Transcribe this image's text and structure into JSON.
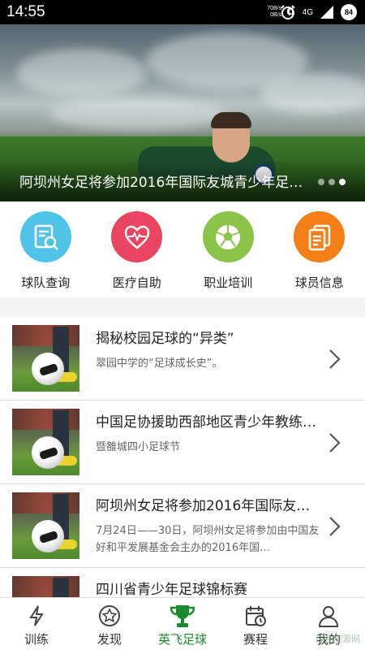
{
  "status_bar": {
    "time": "14:55",
    "net_up": "70B/s",
    "net_down": "0B/s",
    "network": "4G",
    "battery": "84"
  },
  "banner": {
    "caption": "阿坝州女足将参加2016年国际友城青少年足…",
    "dot_count": 3,
    "active_dot": 2
  },
  "shortcuts": [
    {
      "label": "球队查询",
      "color": "#4fc3e8",
      "icon": "search-document-icon"
    },
    {
      "label": "医疗自助",
      "color": "#e94560",
      "icon": "heart-pulse-icon"
    },
    {
      "label": "职业培训",
      "color": "#8bc34a",
      "icon": "soccer-ball-icon"
    },
    {
      "label": "球员信息",
      "color": "#f57f17",
      "icon": "documents-icon"
    }
  ],
  "news": [
    {
      "title": "揭秘校园足球的“异类”",
      "subtitle": "翠园中学的“足球成长史”。"
    },
    {
      "title": "中国足协援助西部地区青少年教练…",
      "subtitle": "暨雒城四小足球节"
    },
    {
      "title": "阿坝州女足将参加2016年国际友…",
      "subtitle": "7月24日——30日，阿坝州女足将参加由中国友好和平发展基金会主办的2016年国…"
    },
    {
      "title": "四川省青少年足球锦标赛",
      "subtitle": ""
    }
  ],
  "tabs": [
    {
      "label": "训练",
      "icon": "lightning-icon"
    },
    {
      "label": "发现",
      "icon": "star-circle-icon"
    },
    {
      "label": "英飞足球",
      "icon": "trophy-icon",
      "active": true
    },
    {
      "label": "赛程",
      "icon": "calendar-clock-icon"
    },
    {
      "label": "我的",
      "icon": "person-icon"
    }
  ],
  "watermark": "绿色资源网",
  "colors": {
    "accent": "#1a8a2c",
    "statusbar": "#000000"
  }
}
